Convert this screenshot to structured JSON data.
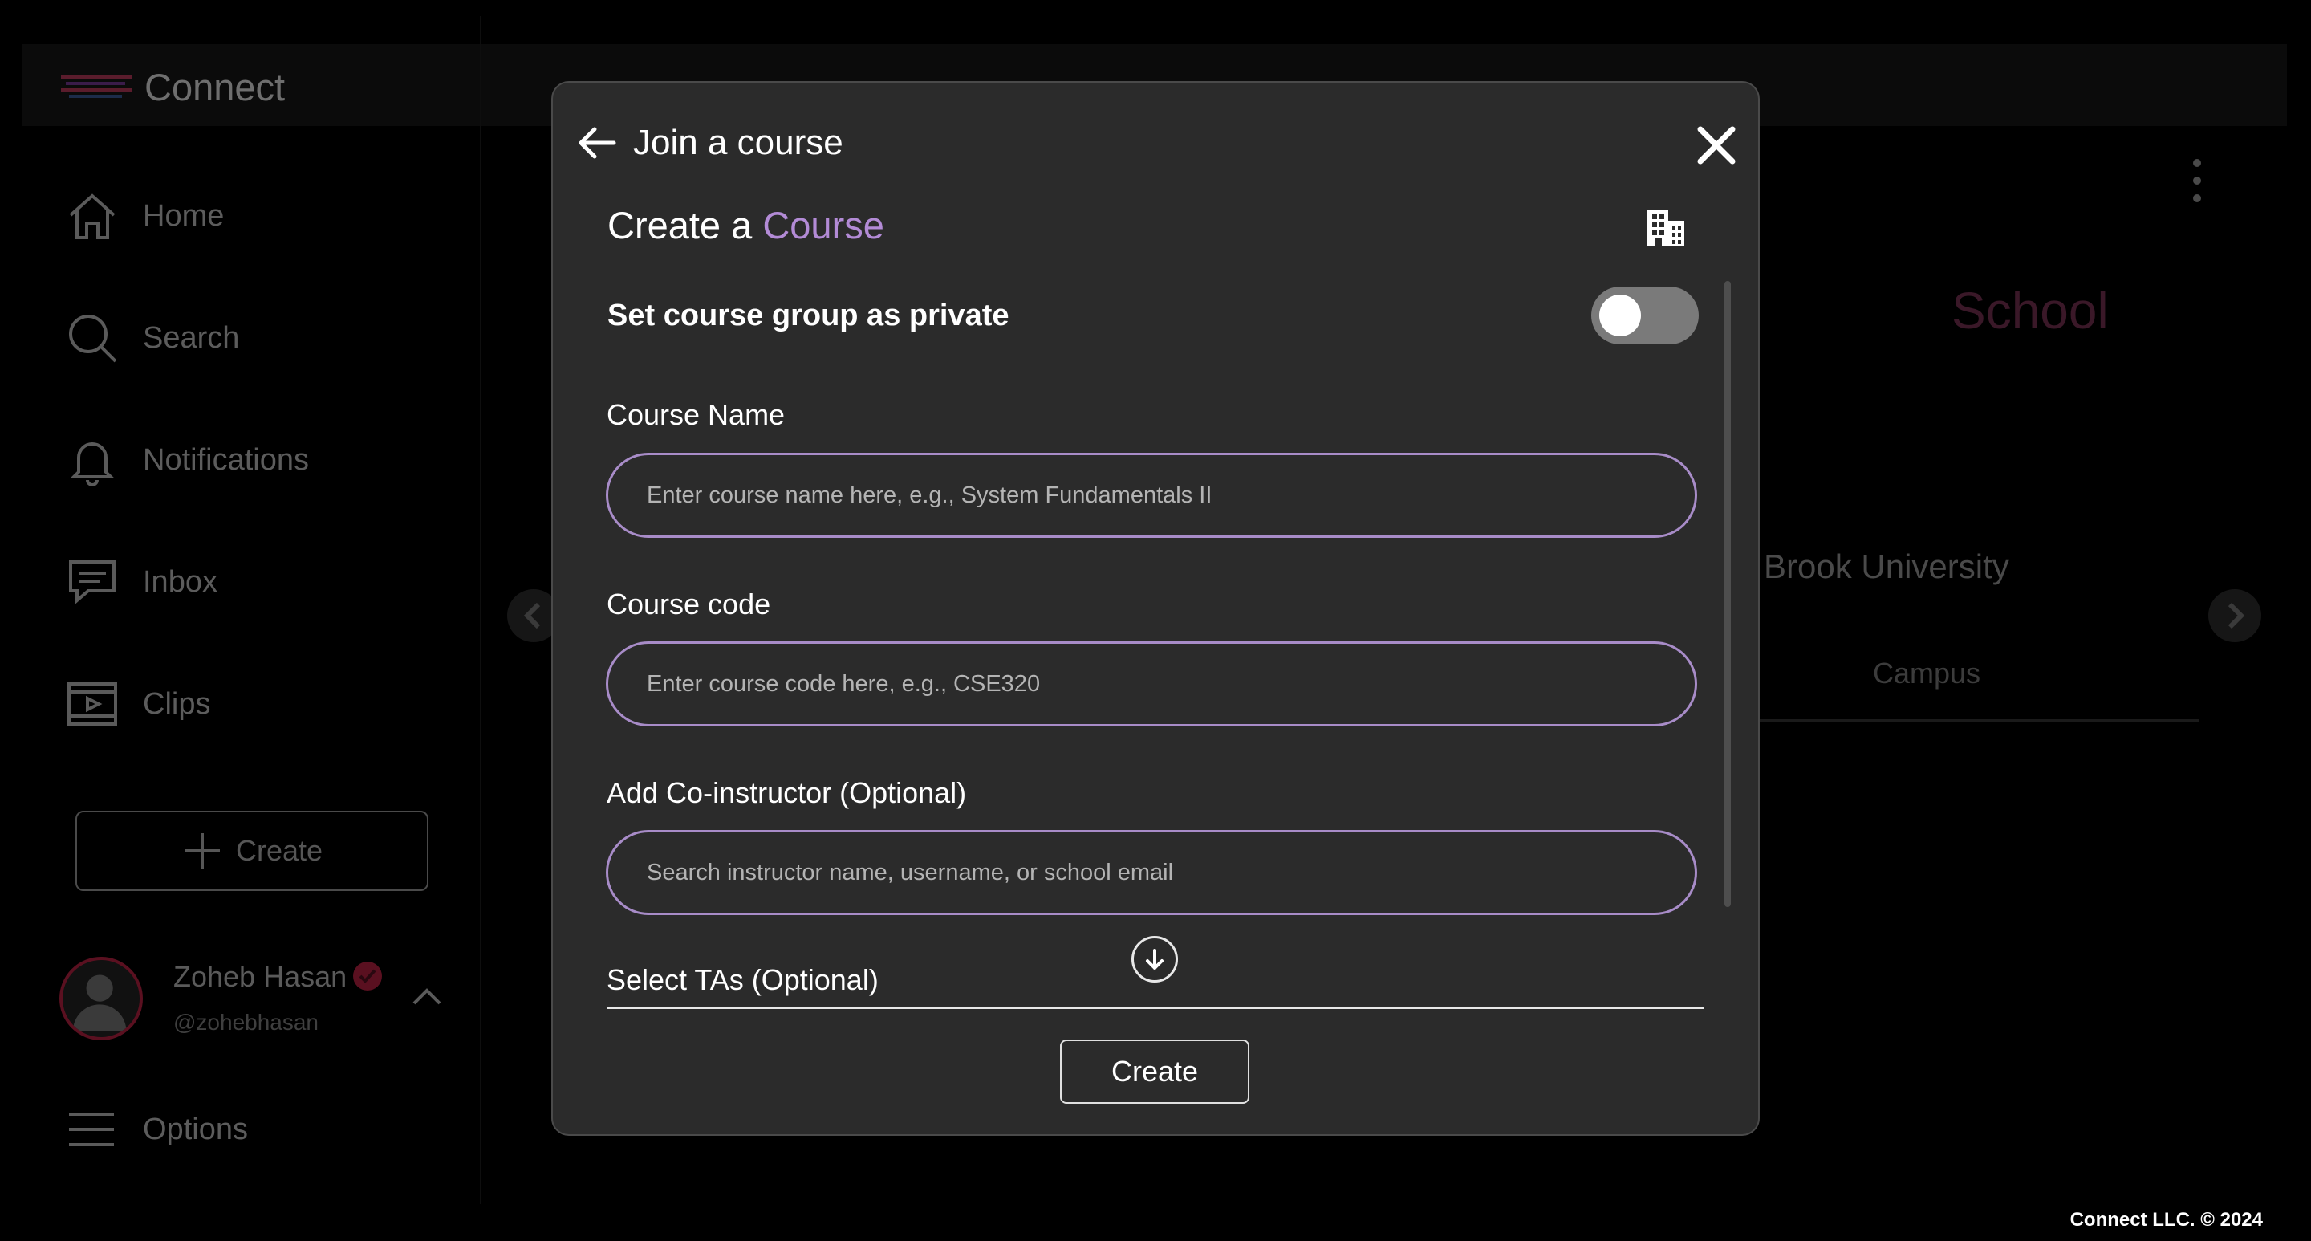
{
  "app": {
    "name": "Connect"
  },
  "sidebar": {
    "items": [
      {
        "label": "Home",
        "icon": "home-icon"
      },
      {
        "label": "Search",
        "icon": "search-icon"
      },
      {
        "label": "Notifications",
        "icon": "bell-icon"
      },
      {
        "label": "Inbox",
        "icon": "inbox-icon"
      },
      {
        "label": "Clips",
        "icon": "clips-icon"
      }
    ],
    "create_label": "Create",
    "options_label": "Options"
  },
  "profile": {
    "name": "Zoheb Hasan",
    "handle": "@zohebhasan"
  },
  "background": {
    "school_label": "School",
    "university_label": "ny Brook University",
    "tab_campus": "Campus"
  },
  "modal": {
    "back_label": "Join a course",
    "title_prefix": "Create a",
    "title_accent": "Course",
    "private_toggle_label": "Set course group as private",
    "private_toggle_on": false,
    "course_name_label": "Course Name",
    "course_name_placeholder": "Enter course name here, e.g., System Fundamentals II",
    "course_code_label": "Course code",
    "course_code_placeholder": "Enter course code here, e.g., CSE320",
    "coinstructor_label": "Add Co-instructor (Optional)",
    "coinstructor_placeholder": "Search instructor name, username, or school email",
    "tas_label": "Select TAs (Optional)",
    "create_button": "Create"
  },
  "footer": {
    "copyright": "Connect LLC. © 2024"
  },
  "colors": {
    "accent": "#b38bd6",
    "field_border": "#a88cc8",
    "modal_bg": "#2b2b2b"
  }
}
